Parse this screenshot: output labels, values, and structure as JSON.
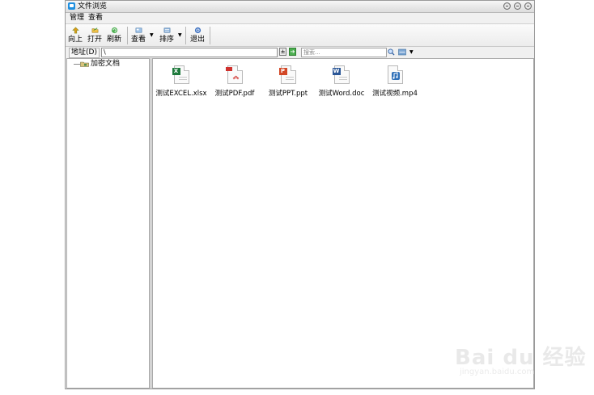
{
  "window": {
    "title": "文件浏览"
  },
  "menu": [
    "管理",
    "查看"
  ],
  "toolbar": {
    "up": "向上",
    "open": "打开",
    "refresh": "刷新",
    "view": "查看",
    "sort": "排序",
    "exit": "退出"
  },
  "address": {
    "label": "地址(D)",
    "value": "\\"
  },
  "search": {
    "placeholder": "搜索..."
  },
  "tree": {
    "root": "加密文档"
  },
  "files": [
    {
      "name": "测试EXCEL.xlsx",
      "icon": "excel-file-icon",
      "badge": "X",
      "color": "#1f7a3d"
    },
    {
      "name": "测试PDF.pdf",
      "icon": "pdf-file-icon",
      "badge": "",
      "color": "#d0312d"
    },
    {
      "name": "测试PPT.ppt",
      "icon": "ppt-file-icon",
      "badge": "P",
      "color": "#d24726"
    },
    {
      "name": "测试Word.doc",
      "icon": "word-file-icon",
      "badge": "W",
      "color": "#2b5797"
    },
    {
      "name": "测试视频.mp4",
      "icon": "video-file-icon",
      "badge": "",
      "color": "#2e6fb7"
    }
  ],
  "watermark": {
    "brand": "Bai du 经验",
    "url": "jingyan.baidu.com"
  }
}
